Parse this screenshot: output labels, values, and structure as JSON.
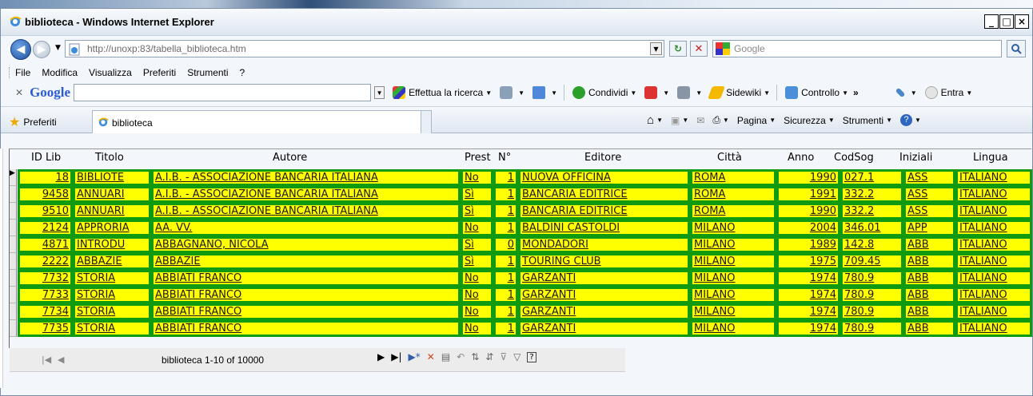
{
  "window": {
    "title": "biblioteca - Windows Internet Explorer",
    "controls": [
      "_",
      "□",
      "×"
    ]
  },
  "address": {
    "url": "http://unoxp:83/tabella_biblioteca.htm",
    "search_placeholder": "Google"
  },
  "menu": [
    "File",
    "Modifica",
    "Visualizza",
    "Preferiti",
    "Strumenti",
    "?"
  ],
  "google_toolbar": {
    "logo": "Google",
    "items": [
      "Effettua la ricerca",
      "Condividi",
      "Sidewiki",
      "Controllo",
      "Entra"
    ]
  },
  "favorites": {
    "label": "Preferiti",
    "tab_title": "biblioteca",
    "commands": [
      "Pagina",
      "Sicurezza",
      "Strumenti"
    ]
  },
  "grid": {
    "columns": [
      "ID Lib",
      "Titolo",
      "Autore",
      "Prest",
      "N°",
      "Editore",
      "Città",
      "Anno",
      "CodSog",
      "Iniziali",
      "Lingua"
    ],
    "rows": [
      [
        "18",
        "BIBLIOTE",
        "A.I.B. - ASSOCIAZIONE BANCARIA ITALIANA",
        "No",
        "1",
        "NUOVA OFFICINA",
        "ROMA",
        "1990",
        "027.1",
        "ASS",
        "ITALIANO"
      ],
      [
        "9458",
        "ANNUARI",
        "A.I.B. - ASSOCIAZIONE BANCARIA ITALIANA",
        "Sì",
        "1",
        "BANCARIA EDITRICE",
        "ROMA",
        "1991",
        "332.2",
        "ASS",
        "ITALIANO"
      ],
      [
        "9510",
        "ANNUARI",
        "A.I.B. - ASSOCIAZIONE BANCARIA ITALIANA",
        "Sì",
        "1",
        "BANCARIA EDITRICE",
        "ROMA",
        "1990",
        "332.2",
        "ASS",
        "ITALIANO"
      ],
      [
        "2124",
        "APPRORIA",
        "AA. VV.",
        "No",
        "1",
        "BALDINI CASTOLDI",
        "MILANO",
        "2004",
        "346.01",
        "APP",
        "ITALIANO"
      ],
      [
        "4871",
        "INTRODU",
        "ABBAGNANO, NICOLA",
        "Sì",
        "0",
        "MONDADORI",
        "MILANO",
        "1989",
        "142.8",
        "ABB",
        "ITALIANO"
      ],
      [
        "2222",
        "ABBAZIE",
        "ABBAZIE",
        "Sì",
        "1",
        "TOURING CLUB",
        "MILANO",
        "1975",
        "709.45",
        "ABB",
        "ITALIANO"
      ],
      [
        "7732",
        "STORIA",
        "ABBIATI FRANCO",
        "No",
        "1",
        "GARZANTI",
        "MILANO",
        "1974",
        "780.9",
        "ABB",
        "ITALIANO"
      ],
      [
        "7733",
        "STORIA",
        "ABBIATI FRANCO",
        "No",
        "1",
        "GARZANTI",
        "MILANO",
        "1974",
        "780.9",
        "ABB",
        "ITALIANO"
      ],
      [
        "7734",
        "STORIA",
        "ABBIATI FRANCO",
        "No",
        "1",
        "GARZANTI",
        "MILANO",
        "1974",
        "780.9",
        "ABB",
        "ITALIANO"
      ],
      [
        "7735",
        "STORIA",
        "ABBIATI FRANCO",
        "No",
        "1",
        "GARZANTI",
        "MILANO",
        "1974",
        "780.9",
        "ABB",
        "ITALIANO"
      ]
    ],
    "navigator_status": "biblioteca 1-10 of 10000"
  },
  "colors": {
    "cell_fill": "#ffff00",
    "cell_border": "#109a10"
  }
}
